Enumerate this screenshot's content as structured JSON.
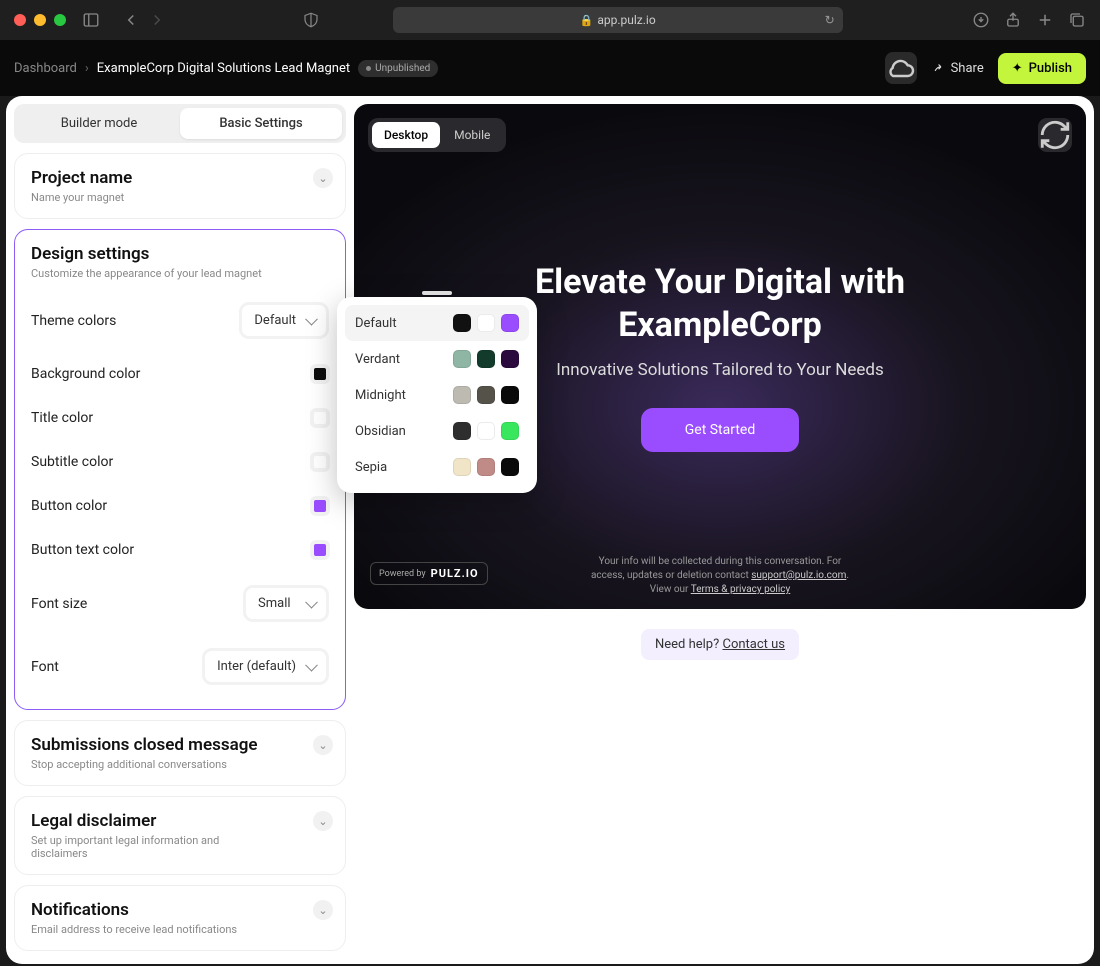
{
  "browser": {
    "url_host": "app.pulz.io"
  },
  "header": {
    "breadcrumb_root": "Dashboard",
    "breadcrumb_current": "ExampleCorp Digital Solutions Lead Magnet",
    "status_badge": "Unpublished",
    "share_label": "Share",
    "publish_label": "Publish"
  },
  "sidebar": {
    "tabs": {
      "builder": "Builder mode",
      "basic": "Basic Settings"
    },
    "panels": {
      "project": {
        "title": "Project name",
        "sub": "Name your magnet"
      },
      "design": {
        "title": "Design settings",
        "sub": "Customize the appearance of your lead magnet",
        "rows": {
          "theme": "Theme colors",
          "bg": "Background color",
          "title_color": "Title color",
          "subtitle_color": "Subtitle color",
          "button_color": "Button color",
          "button_text_color": "Button text color",
          "font_size": "Font size",
          "font": "Font"
        },
        "theme_value": "Default",
        "font_size_value": "Small",
        "font_value": "Inter (default)",
        "swatches": {
          "bg": "#0d0d0d",
          "title": "#ffffff",
          "subtitle": "#ffffff",
          "button": "#9a4dff",
          "button_text": "#9a4dff"
        }
      },
      "submissions": {
        "title": "Submissions closed message",
        "sub": "Stop accepting additional conversations"
      },
      "legal": {
        "title": "Legal disclaimer",
        "sub": "Set up important legal information and disclaimers"
      },
      "notifications": {
        "title": "Notifications",
        "sub": "Email address to receive lead notifications"
      }
    }
  },
  "theme_dropdown": {
    "items": [
      {
        "name": "Default",
        "c1": "#111111",
        "c2": "#ffffff",
        "c3": "#9a4dff",
        "active": true
      },
      {
        "name": "Verdant",
        "c1": "#8fb5a4",
        "c2": "#123b2c",
        "c3": "#2b0a3d"
      },
      {
        "name": "Midnight",
        "c1": "#bdbab2",
        "c2": "#55524a",
        "c3": "#0a0a0a"
      },
      {
        "name": "Obsidian",
        "c1": "#2e2e2e",
        "c2": "#ffffff",
        "c3": "#39e75f"
      },
      {
        "name": "Sepia",
        "c1": "#f1e5c8",
        "c2": "#c08a86",
        "c3": "#0a0a0a"
      }
    ]
  },
  "preview": {
    "device_tabs": {
      "desktop": "Desktop",
      "mobile": "Mobile"
    },
    "hero_title": "Elevate Your Digital with ExampleCorp",
    "hero_sub": "Innovative Solutions Tailored to Your Needs",
    "cta": "Get Started",
    "powered_by": "Powered by",
    "brand": "PULZ.IO",
    "legal_line1": "Your info will be collected during this conversation. For",
    "legal_line2_a": "access, updates or deletion contact ",
    "legal_email": "support@pulz.io.com",
    "legal_line3_a": "View our ",
    "legal_terms": "Terms & privacy policy"
  },
  "help": {
    "prefix": "Need help? ",
    "link": "Contact us"
  }
}
